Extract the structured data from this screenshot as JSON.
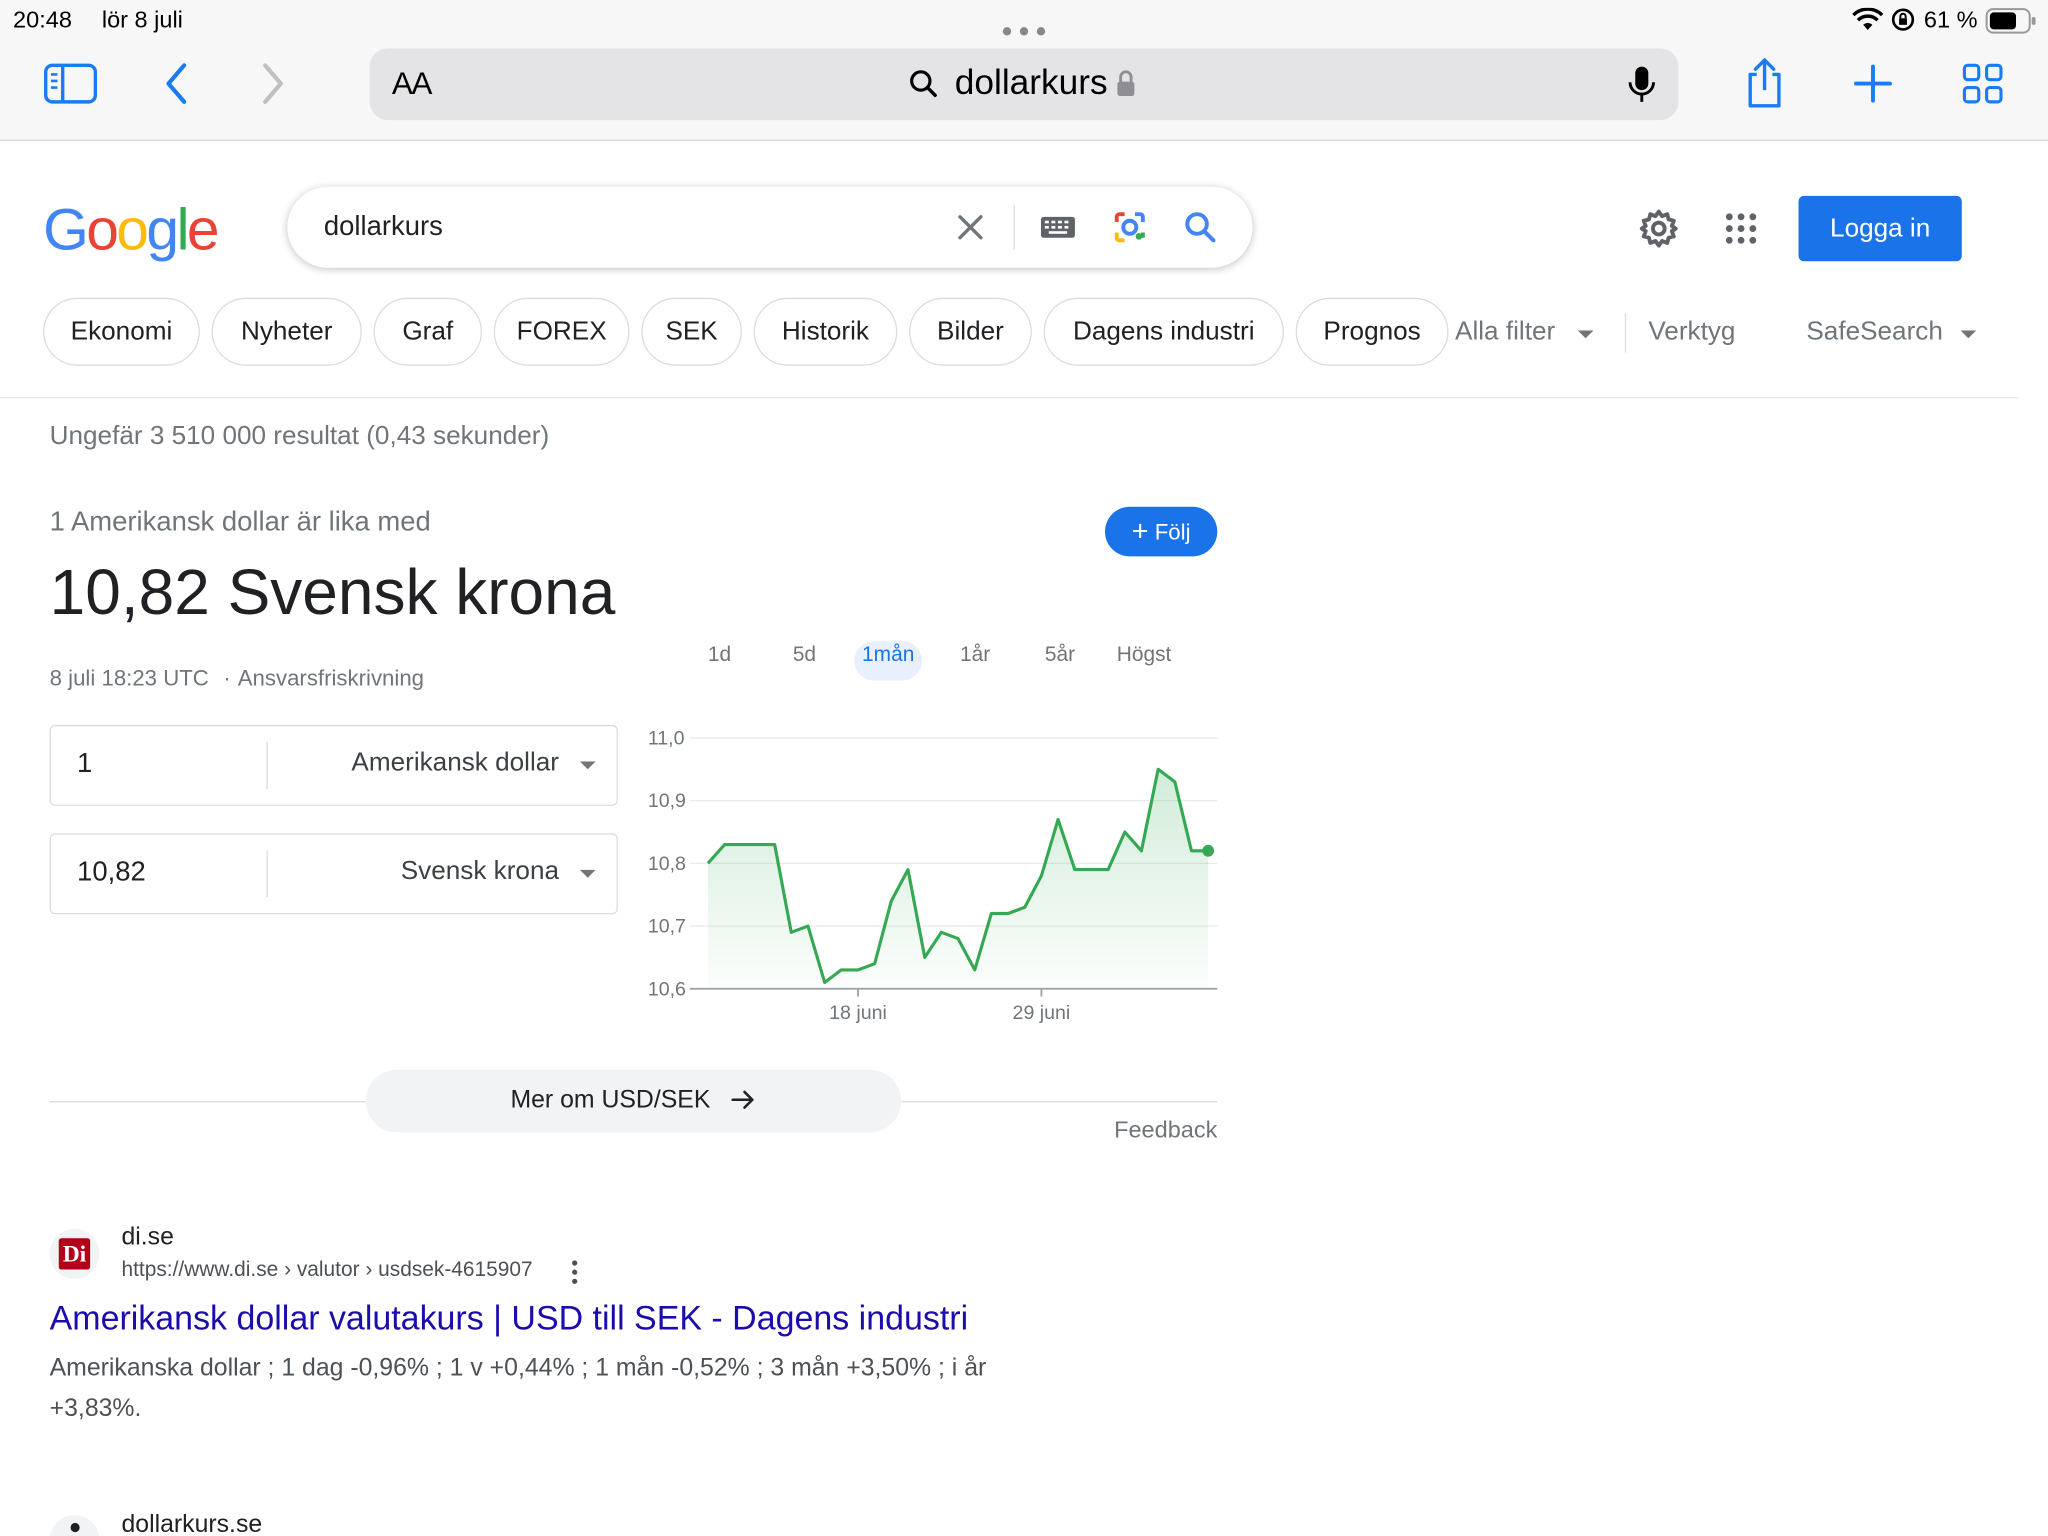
{
  "status_bar": {
    "time": "20:48",
    "date": "lör 8 juli",
    "battery": "61 %"
  },
  "safari": {
    "text_size_label": "AA",
    "address": "dollarkurs"
  },
  "google": {
    "logo": "Google",
    "query": "dollarkurs",
    "login_label": "Logga in",
    "chips": [
      "Ekonomi",
      "Nyheter",
      "Graf",
      "FOREX",
      "SEK",
      "Historik",
      "Bilder",
      "Dagens industri",
      "Prognos"
    ],
    "filters": {
      "all": "Alla filter",
      "tools": "Verktyg",
      "safesearch": "SafeSearch"
    },
    "result_stats": "Ungefär 3 510 000 resultat (0,43 sekunder)"
  },
  "converter": {
    "subtitle": "1 Amerikansk dollar är lika med",
    "headline": "10,82 Svensk krona",
    "timestamp": "8 juli 18:23 UTC",
    "disclaimer": "Ansvarsfriskrivning",
    "follow_label": "Följ",
    "from": {
      "value": "1",
      "currency": "Amerikansk dollar"
    },
    "to": {
      "value": "10,82",
      "currency": "Svensk krona"
    },
    "ranges": [
      "1d",
      "5d",
      "1mån",
      "1år",
      "5år",
      "Högst"
    ],
    "active_range": "1mån",
    "more_label": "Mer om USD/SEK",
    "feedback": "Feedback"
  },
  "chart_data": {
    "type": "area",
    "title": "",
    "xlabel": "",
    "ylabel": "",
    "ylim": [
      10.6,
      11.0
    ],
    "yticks": [
      "11,0",
      "10,9",
      "10,8",
      "10,7",
      "10,6"
    ],
    "xtick_labels": [
      "18 juni",
      "29 juni"
    ],
    "line_color": "#34a853",
    "series": [
      {
        "values": [
          10.8,
          10.83,
          10.83,
          10.83,
          10.83,
          10.69,
          10.7,
          10.61,
          10.63,
          10.63,
          10.64,
          10.74,
          10.79,
          10.65,
          10.69,
          10.68,
          10.63,
          10.72,
          10.72,
          10.73,
          10.78,
          10.87,
          10.79,
          10.79,
          10.79,
          10.85,
          10.82,
          10.95,
          10.93,
          10.82,
          10.82
        ]
      }
    ]
  },
  "results": [
    {
      "favicon_text": "Di",
      "site": "di.se",
      "url": "https://www.di.se › valutor › usdsek-4615907",
      "title": "Amerikansk dollar valutakurs | USD till SEK - Dagens industri",
      "snippet_line1": "Amerikanska dollar ; 1 dag -0,96% ; 1 v +0,44% ; 1 mån -0,52% ; 3 mån +3,50% ; i år",
      "snippet_line2": "+3,83%."
    },
    {
      "site": "dollarkurs.se"
    }
  ],
  "colors": {
    "accent": "#1a73e8",
    "link": "#1a0dab",
    "chart_line": "#34a853"
  }
}
